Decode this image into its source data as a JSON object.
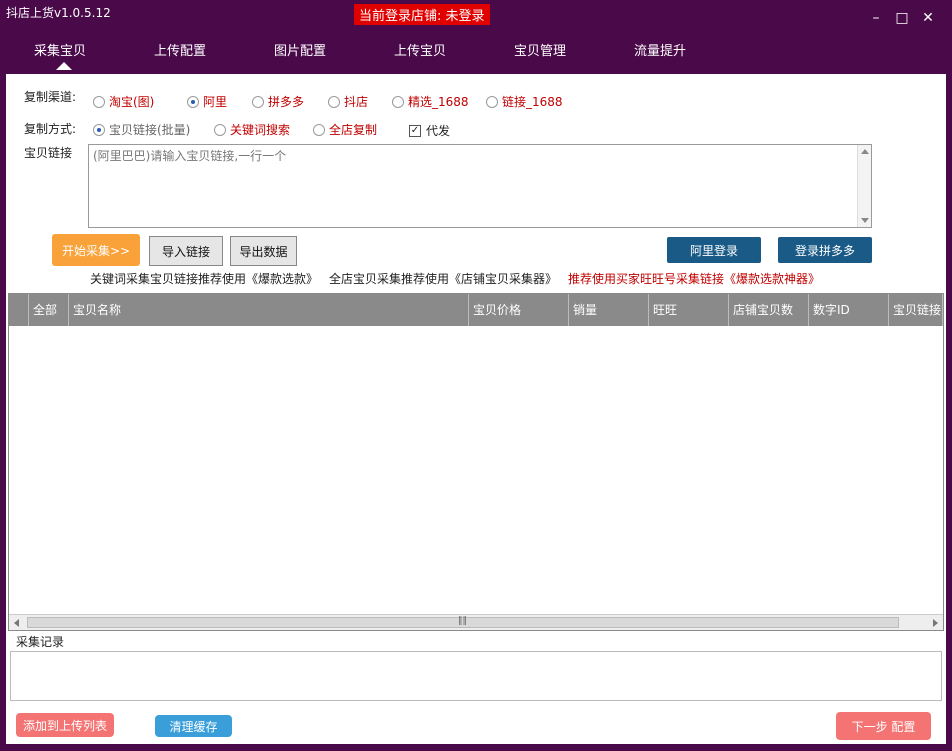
{
  "window": {
    "title": "抖店上货v1.0.5.12",
    "login_status": "当前登录店铺: 未登录"
  },
  "nav": {
    "tabs": [
      "采集宝贝",
      "上传配置",
      "图片配置",
      "上传宝贝",
      "宝贝管理",
      "流量提升"
    ],
    "active_index": 0
  },
  "channel": {
    "label": "复制渠道:",
    "options": [
      "淘宝(图)",
      "阿里",
      "拼多多",
      "抖店",
      "精选_1688",
      "链接_1688"
    ],
    "selected": "阿里"
  },
  "method": {
    "label": "复制方式:",
    "options": [
      "宝贝链接(批量)",
      "关键词搜索",
      "全店复制"
    ],
    "selected": "宝贝链接(批量)",
    "proxy_label": "代发",
    "proxy_checked": true
  },
  "links": {
    "label": "宝贝链接",
    "placeholder": "(阿里巴巴)请输入宝贝链接,一行一个"
  },
  "buttons": {
    "start": "开始采集>>",
    "import": "导入链接",
    "export": "导出数据",
    "ali_login": "阿里登录",
    "pdd_login": "登录拼多多",
    "add_upload": "添加到上传列表",
    "clear_cache": "清理缓存",
    "next_step": "下一步 配置"
  },
  "promos": [
    "关键词采集宝贝链接推荐使用《爆款选款》",
    "全店宝贝采集推荐使用《店铺宝贝采集器》",
    "推荐使用买家旺旺号采集链接《爆款选款神器》"
  ],
  "table": {
    "columns": [
      "",
      "全部",
      "宝贝名称",
      "宝贝价格",
      "销量",
      "旺旺",
      "店铺宝贝数",
      "数字ID",
      "宝贝链接"
    ]
  },
  "log": {
    "label": "采集记录"
  },
  "colors": {
    "frame": "#4a0a4a",
    "login_badge": "#e00000",
    "accent_red": "#c00000",
    "grid_header": "#8a8a8a"
  }
}
